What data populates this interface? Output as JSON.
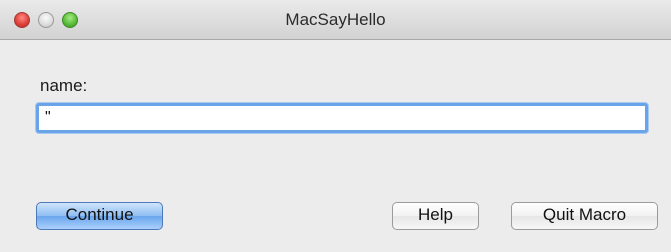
{
  "window": {
    "title": "MacSayHello"
  },
  "form": {
    "name_label": "name:",
    "name_value": "\""
  },
  "buttons": {
    "continue_label": "Continue",
    "help_label": "Help",
    "quit_label": "Quit Macro"
  },
  "colors": {
    "accent": "#6aa4e8",
    "window_bg": "#ececec"
  }
}
